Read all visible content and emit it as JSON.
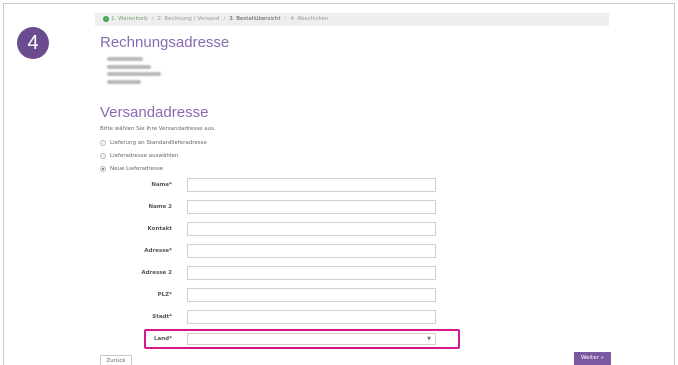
{
  "step_number": "4",
  "breadcrumb": {
    "step1": "1. Warenkorb",
    "step2": "2. Rechnung / Versand",
    "step3": "3. Bestellübersicht",
    "step4": "4. Abschicken",
    "separator": "/"
  },
  "billing": {
    "title": "Rechnungsadresse"
  },
  "shipping": {
    "title": "Versandadresse",
    "intro": "Bitte wählen Sie Ihre Versandadresse aus.",
    "options": [
      {
        "label": "Lieferung an Standardlieferadresse",
        "checked": false
      },
      {
        "label": "Lieferadresse auswählen",
        "checked": false
      },
      {
        "label": "Neue Lieferadresse",
        "checked": true
      }
    ]
  },
  "form": {
    "fields": [
      {
        "label": "Name*",
        "value": ""
      },
      {
        "label": "Name 2",
        "value": ""
      },
      {
        "label": "Kontakt",
        "value": ""
      },
      {
        "label": "Adresse*",
        "value": ""
      },
      {
        "label": "Adresse 2",
        "value": ""
      },
      {
        "label": "PLZ*",
        "value": ""
      },
      {
        "label": "Stadt*",
        "value": ""
      }
    ],
    "land_label": "Land*",
    "land_value": ""
  },
  "buttons": {
    "back": "Zurück",
    "next": "Weiter »"
  },
  "colors": {
    "accent": "#7b59a0",
    "highlight": "#d4178a",
    "done": "#3fa34d"
  }
}
